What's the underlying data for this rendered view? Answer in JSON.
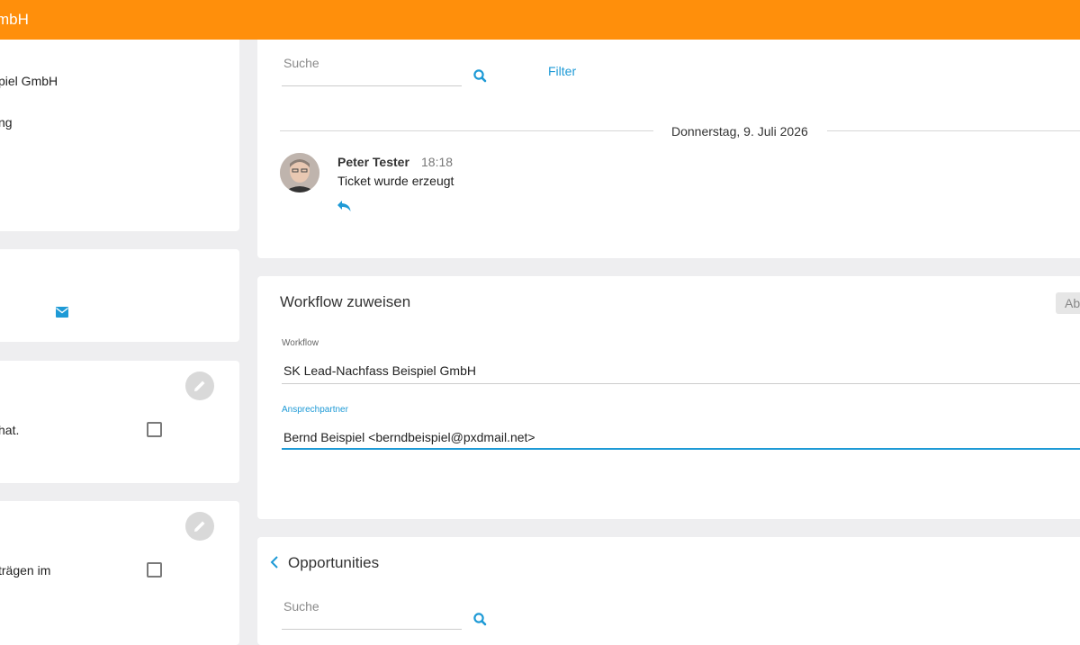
{
  "header": {
    "title": "mbH"
  },
  "left": {
    "card1": {
      "line1": "piel GmbH",
      "line2": "ng"
    },
    "card3": {
      "text": "hat."
    },
    "card4": {
      "text": "trägen im"
    }
  },
  "feed": {
    "search_placeholder": "Suche",
    "filter_label": "Filter",
    "date": "Donnerstag, 9. Juli 2026",
    "entry": {
      "author": "Peter Tester",
      "time": "18:18",
      "message": "Ticket wurde erzeugt"
    }
  },
  "workflow": {
    "title": "Workflow zuweisen",
    "button_label": "Ab",
    "workflow_label": "Workflow",
    "workflow_value": "SK Lead-Nachfass Beispiel GmbH",
    "contact_label": "Ansprechpartner",
    "contact_value": "Bernd Beispiel <berndbeispiel@pxdmail.net>"
  },
  "opportunities": {
    "title": "Opportunities",
    "search_placeholder": "Suche"
  },
  "colors": {
    "accent": "#ff8f0b",
    "link": "#1e9ad6"
  }
}
